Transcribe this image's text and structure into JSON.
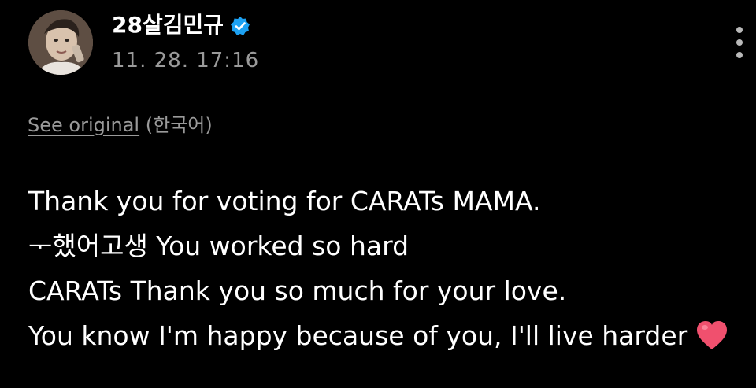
{
  "post": {
    "author_name": "28살김민규",
    "timestamp": "11. 28. 17:16",
    "see_original_label": "See original",
    "original_language": "(한국어)",
    "body_lines": [
      "Thank you for voting for CARATs MAMA.",
      "ᅮ했어고생 You worked so hard",
      "CARATs Thank you so much for your love.",
      "You know I'm happy because of you, I'll live harder"
    ],
    "trailing_emoji": "heart-icon"
  },
  "colors": {
    "background": "#000000",
    "text_primary": "#ffffff",
    "text_secondary": "#9a9a9a",
    "verified_badge": "#1da1f2",
    "heart": "#f0506e"
  },
  "icons": {
    "verified": "verified-badge-icon",
    "more": "more-vertical-icon",
    "heart": "heart-icon"
  }
}
